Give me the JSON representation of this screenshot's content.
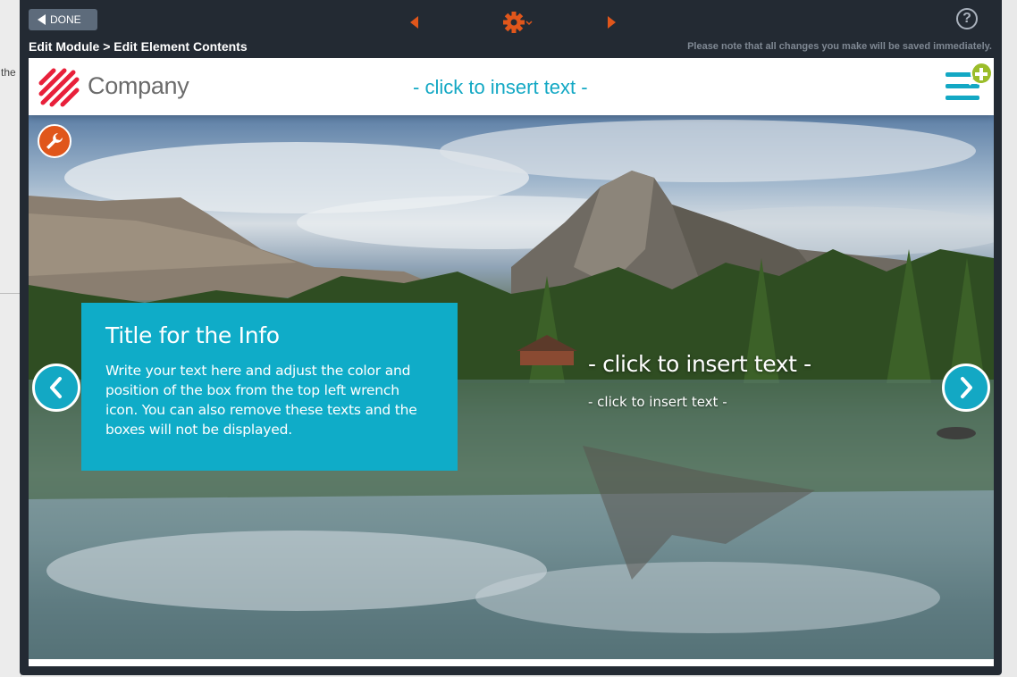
{
  "background": {
    "side_text": "the"
  },
  "toolbar": {
    "done_label": "DONE",
    "help_label": "?",
    "icons": {
      "prev": "triangle-left-icon",
      "next": "triangle-right-icon",
      "settings": "gear-icon",
      "help": "question-circle-icon"
    }
  },
  "breadcrumb": "Edit Module > Edit Element Contents",
  "notice": "Please note that all changes you make will be saved immediately.",
  "module": {
    "logo_text": "Company",
    "header_text": "- click to insert text -",
    "info_box": {
      "title": "Title for the Info",
      "body": "Write your text here and adjust the color and position of the box from the top left wrench icon. You can also remove these texts and the boxes will not be displayed."
    },
    "hero_title": "- click to insert text -",
    "hero_subtitle": "- click to insert text -"
  },
  "colors": {
    "accent": "#13a8c4",
    "orange": "#e0561b",
    "frame": "#232a33",
    "logo_red": "#e8203a",
    "add_green": "#9bbd2a"
  }
}
